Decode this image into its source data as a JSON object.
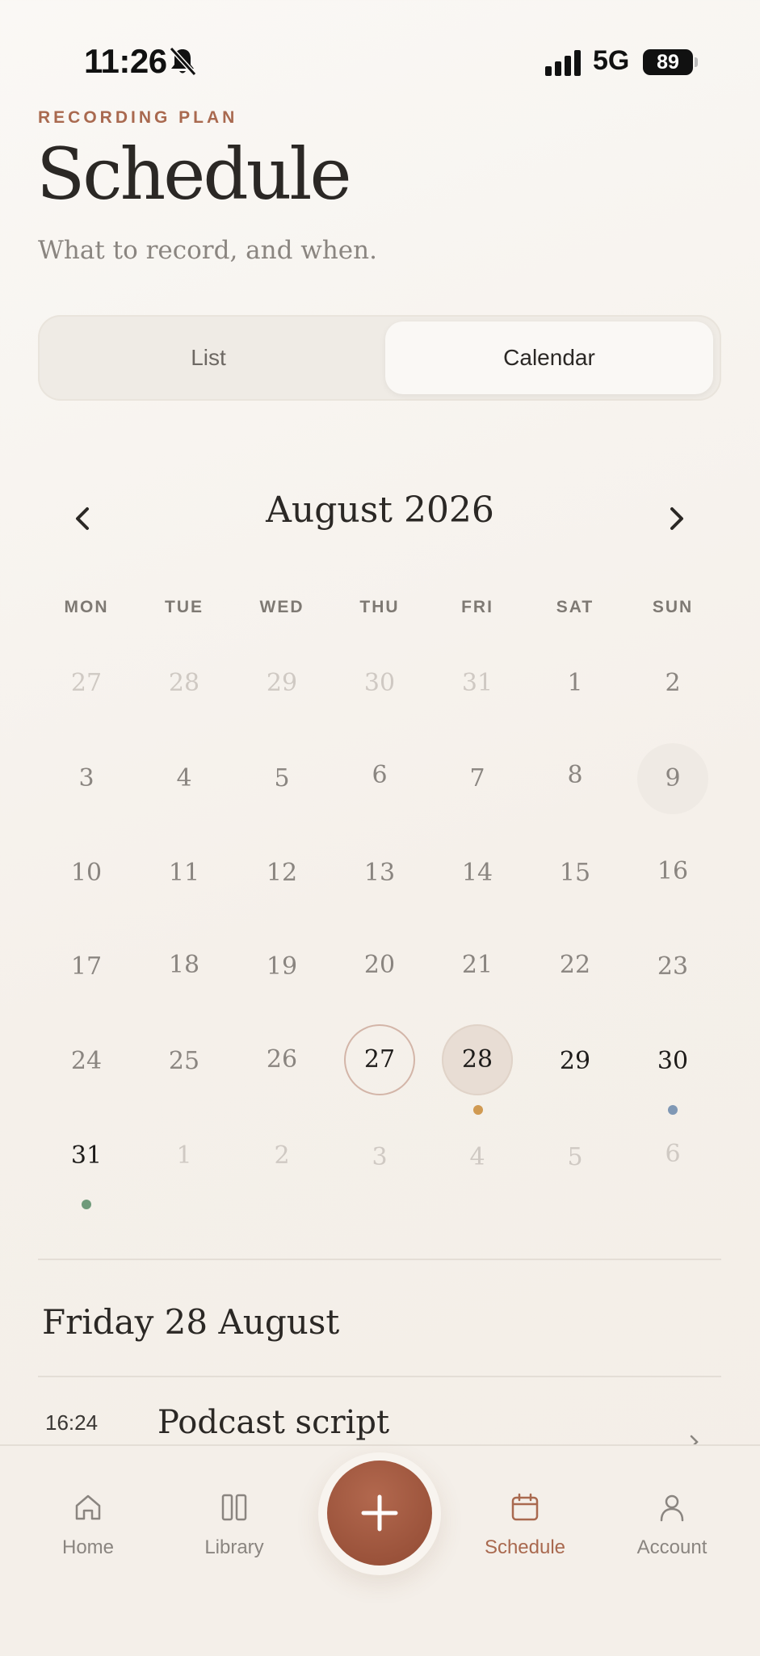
{
  "status_bar": {
    "time": "11:26",
    "network": "5G",
    "battery": "89"
  },
  "header": {
    "eyebrow": "RECORDING PLAN",
    "title": "Schedule",
    "subtitle": "What to record, and when."
  },
  "view_toggle": {
    "options": [
      "List",
      "Calendar"
    ],
    "selected": "Calendar"
  },
  "calendar": {
    "month_label": "August 2026",
    "weekdays": [
      "MON",
      "TUE",
      "WED",
      "THU",
      "FRI",
      "SAT",
      "SUN"
    ],
    "weeks": [
      [
        "27",
        "28",
        "29",
        "30",
        "31",
        "1",
        "2"
      ],
      [
        "3",
        "4",
        "5",
        "6",
        "7",
        "8",
        "9"
      ],
      [
        "10",
        "11",
        "12",
        "13",
        "14",
        "15",
        "16"
      ],
      [
        "17",
        "18",
        "19",
        "20",
        "21",
        "22",
        "23"
      ],
      [
        "24",
        "25",
        "26",
        "27",
        "28",
        "29",
        "30"
      ],
      [
        "31",
        "1",
        "2",
        "3",
        "4",
        "5",
        "6"
      ]
    ],
    "today": "27",
    "selected": "28",
    "event_dot_colors": {
      "fri_28": "#d09a52",
      "sun_30": "#7f98b5",
      "mon_31": "#6f9a7a"
    }
  },
  "selected_day": {
    "heading": "Friday 28 August",
    "items": [
      {
        "time": "16:24",
        "title": "Podcast script"
      }
    ]
  },
  "tab_bar": {
    "tabs": [
      "Home",
      "Library",
      "Schedule",
      "Account"
    ],
    "active": "Schedule",
    "accent": "#a9694f"
  }
}
